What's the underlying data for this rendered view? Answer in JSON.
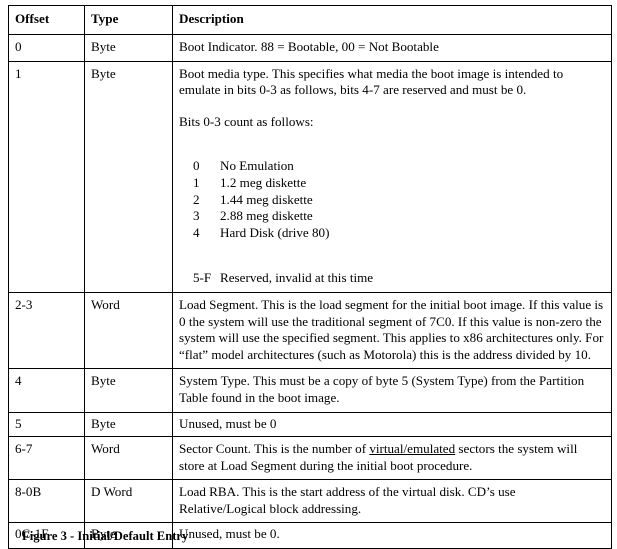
{
  "figure": {
    "caption": "Figure 3 - Initial/Default Entry"
  },
  "table": {
    "headers": {
      "offset": "Offset",
      "type": "Type",
      "description": "Description"
    },
    "rows": [
      {
        "offset": "0",
        "type": "Byte",
        "description": "Boot Indicator.  88 = Bootable, 00 = Not Bootable"
      },
      {
        "offset": "1",
        "type": "Byte",
        "description_p1": "Boot media type.  This specifies what  media the boot image is intended to emulate in bits 0-3 as follows, bits 4-7 are reserved and must be  0.",
        "description_p2": "Bits 0-3 count as follows:",
        "bits": [
          {
            "code": "0",
            "label": "No Emulation"
          },
          {
            "code": "1",
            "label": "1.2 meg diskette"
          },
          {
            "code": "2",
            "label": "1.44 meg diskette"
          },
          {
            "code": "3",
            "label": "2.88 meg diskette"
          },
          {
            "code": "4",
            "label": "Hard Disk (drive 80)"
          }
        ],
        "reserved_code": "5-F",
        "reserved_label": "Reserved, invalid at this time"
      },
      {
        "offset": "2-3",
        "type": "Word",
        "description": "Load Segment.  This is the load segment for the initial boot image.  If this value is 0 the system will use the traditional segment of 7C0.  If this value is non-zero the system will use the specified segment.  This applies to x86 architectures only.  For “flat” model architectures (such as Motorola) this is the address divided by 10."
      },
      {
        "offset": "4",
        "type": "Byte",
        "description": "System Type.  This must be a copy of byte 5 (System Type) from the Partition Table found in the boot image."
      },
      {
        "offset": "5",
        "type": "Byte",
        "description": "Unused, must be 0"
      },
      {
        "offset": "6-7",
        "type": "Word",
        "description_pre": "Sector Count.  This is the number of ",
        "description_u1": "virtual",
        "description_mid": "/",
        "description_u2": "emulated",
        "description_post": " sectors the system will store at Load Segment during the initial boot procedure."
      },
      {
        "offset": "8-0B",
        "type": "D Word",
        "description": "Load RBA.  This is the start address of the virtual disk.  CD’s use Relative/Logical block addressing."
      },
      {
        "offset": "0C-1F",
        "type": "Byte",
        "description": "Unused, must be 0."
      }
    ]
  },
  "colors": {
    "text": "#000000",
    "border": "#000000",
    "background": "#ffffff"
  }
}
